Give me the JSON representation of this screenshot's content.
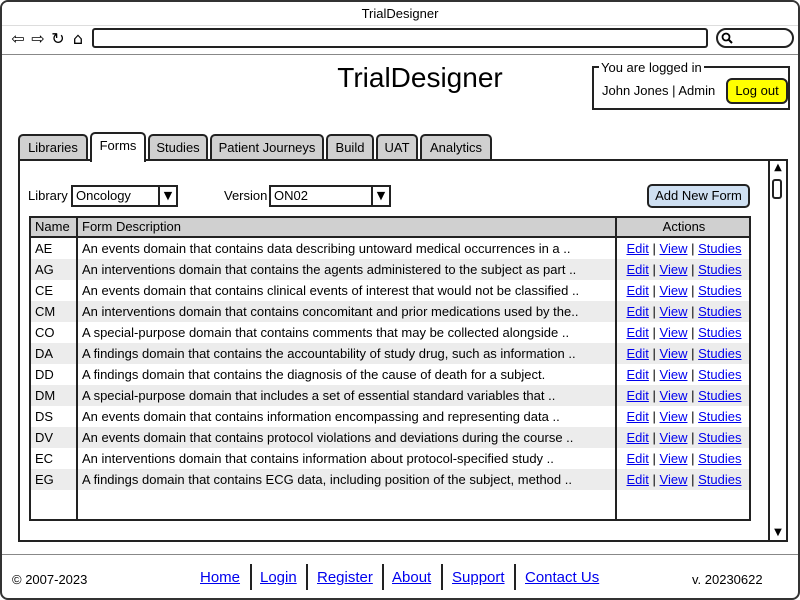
{
  "browser": {
    "title": "TrialDesigner",
    "icons": [
      "back-icon",
      "forward-icon",
      "reload-icon",
      "home-icon",
      "search-icon"
    ]
  },
  "header": {
    "app_title": "TrialDesigner",
    "login": {
      "legend": "You are logged in",
      "user": "John Jones | Admin",
      "logout_label": "Log out"
    }
  },
  "tabs": [
    {
      "label": "Libraries"
    },
    {
      "label": "Forms",
      "active": true
    },
    {
      "label": "Studies"
    },
    {
      "label": "Patient Journeys"
    },
    {
      "label": "Build"
    },
    {
      "label": "UAT"
    },
    {
      "label": "Analytics"
    }
  ],
  "filters": {
    "library_label": "Library",
    "library_value": "Oncology",
    "version_label": "Version",
    "version_value": "ON02",
    "add_button": "Add New Form"
  },
  "table": {
    "headers": {
      "name": "Name",
      "description": "Form Description",
      "actions": "Actions"
    },
    "action_labels": {
      "edit": "Edit",
      "view": "View",
      "studies": "Studies",
      "sep": "|"
    },
    "rows": [
      {
        "name": "AE",
        "description": "An events domain that contains data describing untoward medical occurrences in a .."
      },
      {
        "name": "AG",
        "description": "An interventions domain that contains the agents administered to the subject as part .."
      },
      {
        "name": "CE",
        "description": "An events domain that contains clinical events of interest that would not be classified .."
      },
      {
        "name": "CM",
        "description": "An interventions domain that contains concomitant and prior medications used by the.."
      },
      {
        "name": "CO",
        "description": "A special-purpose domain that contains comments that may be collected alongside .."
      },
      {
        "name": "DA",
        "description": "A findings domain that contains the accountability of study drug, such as information .."
      },
      {
        "name": "DD",
        "description": "A findings domain that contains the diagnosis of the cause of death for a subject."
      },
      {
        "name": "DM",
        "description": "A special-purpose domain that includes a set of essential standard variables that .."
      },
      {
        "name": "DS",
        "description": "An events domain that contains information encompassing and representing data .."
      },
      {
        "name": "DV",
        "description": "An events domain that contains protocol violations and deviations during the course .."
      },
      {
        "name": "EC",
        "description": "An interventions domain that contains information about protocol-specified study .."
      },
      {
        "name": "EG",
        "description": "A findings domain that contains ECG data, including position of the subject, method .."
      }
    ]
  },
  "footer": {
    "copyright": "© 2007-2023",
    "version": "v. 20230622",
    "links": [
      "Home",
      "Login",
      "Register",
      "About",
      "Support",
      "Contact Us"
    ]
  },
  "colors": {
    "logout_button": "#ffff00",
    "add_button": "#cfe0f2",
    "tab_inactive": "#d0d0d0",
    "row_alt": "#ececec",
    "link": "#0000ee"
  }
}
